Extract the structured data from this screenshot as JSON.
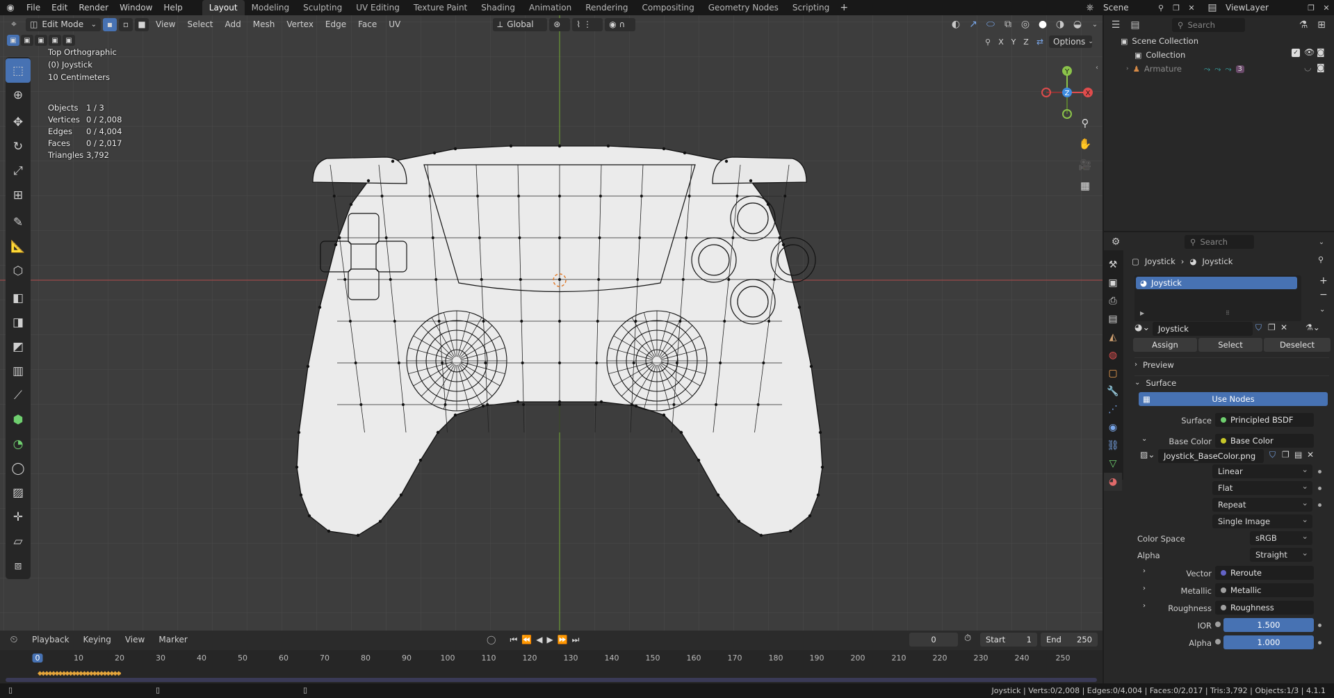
{
  "topbar": {
    "menus": [
      "File",
      "Edit",
      "Render",
      "Window",
      "Help"
    ],
    "workspaces": [
      "Layout",
      "Modeling",
      "Sculpting",
      "UV Editing",
      "Texture Paint",
      "Shading",
      "Animation",
      "Rendering",
      "Compositing",
      "Geometry Nodes",
      "Scripting"
    ],
    "scene_label": "Scene",
    "viewlayer_label": "ViewLayer"
  },
  "viewport": {
    "mode": "Edit Mode",
    "menus": [
      "View",
      "Select",
      "Add",
      "Mesh",
      "Vertex",
      "Edge",
      "Face",
      "UV"
    ],
    "transform_orientation": "Global",
    "axis_labels": [
      "X",
      "Y",
      "Z"
    ],
    "options_label": "Options",
    "view_name": "Top Orthographic",
    "object_name": "(0) Joystick",
    "grid_scale": "10 Centimeters",
    "stats": [
      {
        "label": "Objects",
        "value": "1 / 3"
      },
      {
        "label": "Vertices",
        "value": "0 / 2,008"
      },
      {
        "label": "Edges",
        "value": "0 / 4,004"
      },
      {
        "label": "Faces",
        "value": "0 / 2,017"
      },
      {
        "label": "Triangles",
        "value": "3,792"
      }
    ],
    "gizmo": {
      "y": "Y",
      "z": "Z",
      "x": "X"
    }
  },
  "timeline": {
    "menus": [
      "Playback",
      "Keying",
      "View",
      "Marker"
    ],
    "current_frame": "0",
    "start_label": "Start",
    "start_value": "1",
    "end_label": "End",
    "end_value": "250",
    "ruler_ticks": [
      "0",
      "10",
      "20",
      "30",
      "40",
      "50",
      "60",
      "70",
      "80",
      "90",
      "100",
      "110",
      "120",
      "130",
      "140",
      "150",
      "160",
      "170",
      "180",
      "190",
      "200",
      "210",
      "220",
      "230",
      "240",
      "250"
    ],
    "playhead_frame": "0"
  },
  "outliner": {
    "search_placeholder": "Search",
    "items": [
      {
        "label": "Scene Collection"
      },
      {
        "label": "Collection"
      },
      {
        "label": "Armature"
      }
    ],
    "armature_badge": "3"
  },
  "properties": {
    "search_placeholder": "Search",
    "breadcrumb": [
      "Joystick",
      "Joystick"
    ],
    "material_slot": "Joystick",
    "material_name": "Joystick",
    "buttons": {
      "assign": "Assign",
      "select": "Select",
      "deselect": "Deselect"
    },
    "sections": {
      "preview": "Preview",
      "surface": "Surface"
    },
    "use_nodes_label": "Use Nodes",
    "surface_label": "Surface",
    "surface_value": "Principled BSDF",
    "base_color_label": "Base Color",
    "base_color_value": "Base Color",
    "image_name": "Joystick_BaseColor.png",
    "interpolation": "Linear",
    "projection": "Flat",
    "extension": "Repeat",
    "source": "Single Image",
    "color_space_label": "Color Space",
    "color_space_value": "sRGB",
    "alpha_label": "Alpha",
    "alpha_value": "Straight",
    "vector_label": "Vector",
    "vector_value": "Reroute",
    "metallic_label": "Metallic",
    "metallic_value": "Metallic",
    "roughness_label": "Roughness",
    "roughness_value": "Roughness",
    "ior_label": "IOR",
    "ior_value": "1.500",
    "alpha2_label": "Alpha",
    "alpha2_value": "1.000"
  },
  "statusbar": {
    "text": "Joystick | Verts:0/2,008 | Edges:0/4,004 | Faces:0/2,017 | Tris:3,792 | Objects:1/3 | 4.1.1"
  },
  "colors": {
    "accent": "#4772b3",
    "x_axis": "#e04c4c",
    "y_axis": "#8bc34a",
    "z_axis": "#3d8be0",
    "socket": "#c7c729"
  }
}
